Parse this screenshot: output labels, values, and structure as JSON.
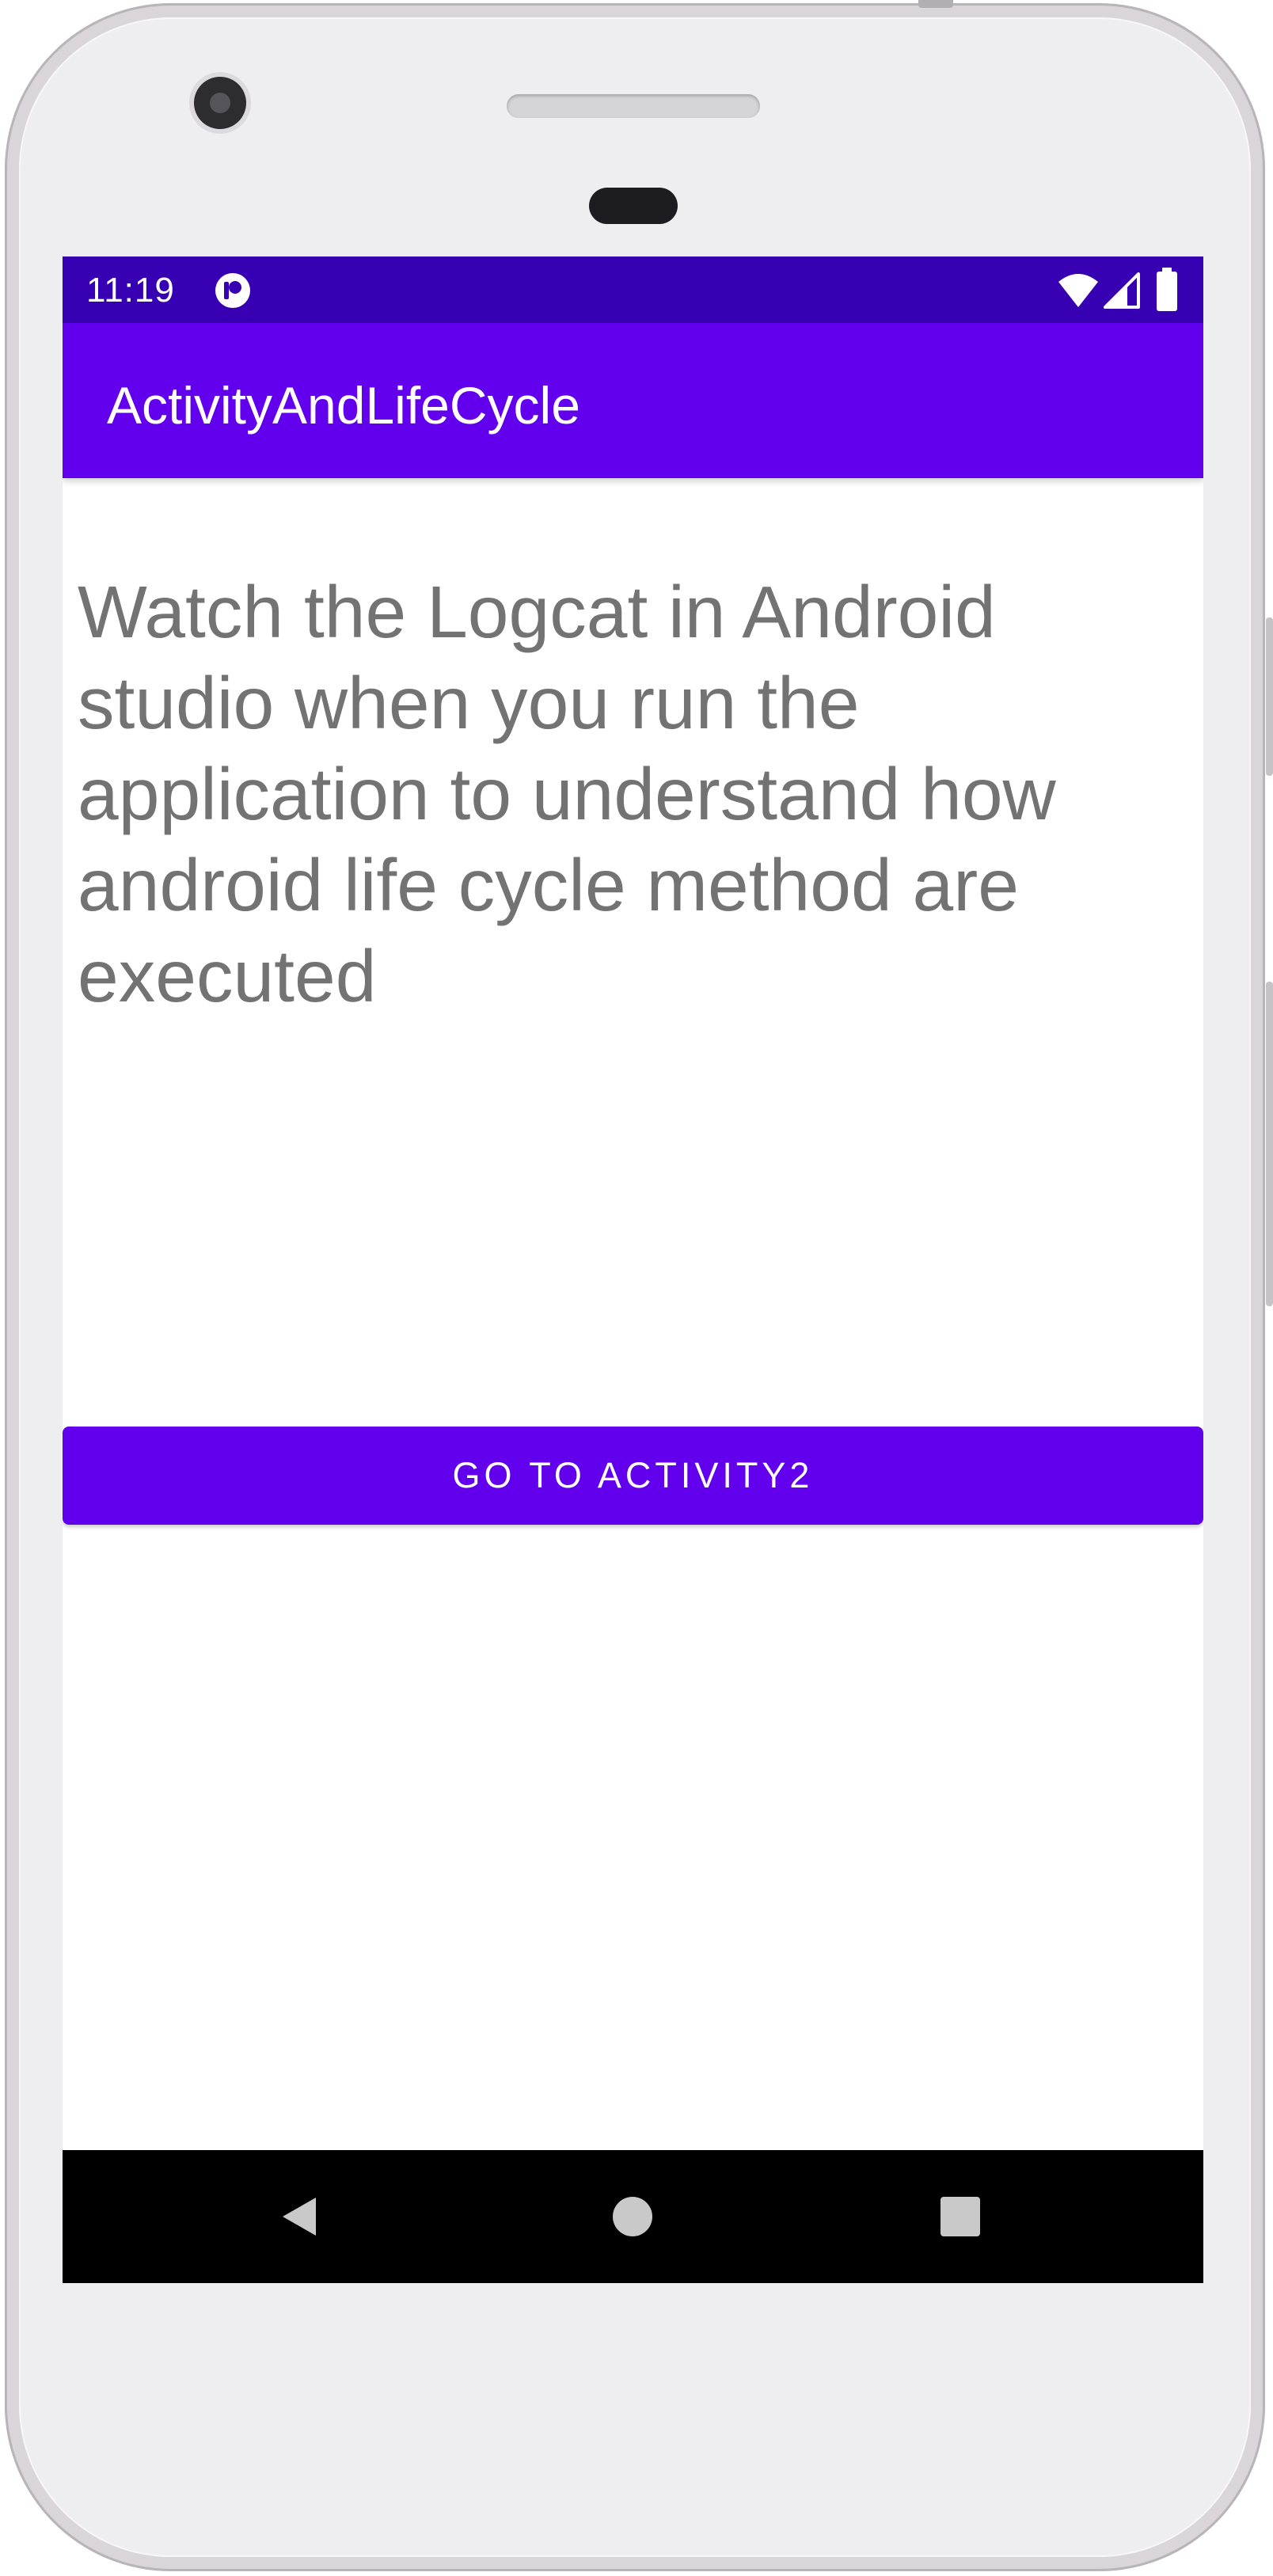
{
  "status_bar": {
    "time": "11:19",
    "background": "#3700b3",
    "icons": [
      "app-notification-icon",
      "wifi-icon",
      "signal-icon",
      "battery-icon"
    ]
  },
  "app_bar": {
    "title": "ActivityAndLifeCycle",
    "background": "#6200ee"
  },
  "main": {
    "instruction_text": "Watch the Logcat in Android studio when you run the application to understand how android life cycle method are executed",
    "button_label": "GO TO ACTIVITY2",
    "button_color": "#6200ee"
  },
  "navigation_bar": {
    "background": "#000000",
    "icons": [
      "back-icon",
      "home-icon",
      "recents-icon"
    ]
  }
}
